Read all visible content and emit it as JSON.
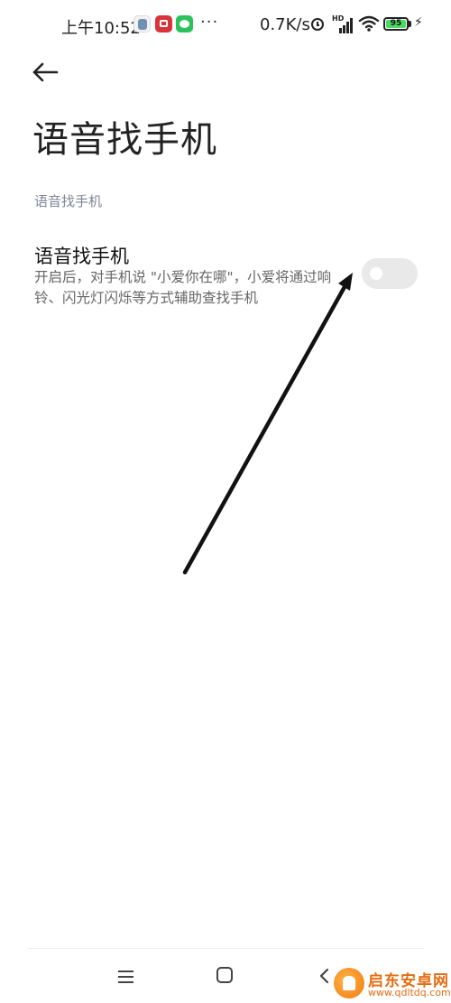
{
  "status_bar": {
    "time": "上午10:52",
    "more_notifications": "···",
    "network_speed": "0.7K/s",
    "signal_label": "HD",
    "battery_level": "95",
    "icons": [
      "app-notification-icon",
      "red-app-icon",
      "wechat-icon",
      "alarm-icon",
      "signal-icon",
      "wifi-icon",
      "battery-icon",
      "charging-icon"
    ]
  },
  "header": {
    "back_icon": "arrow-left-icon",
    "title": "语音找手机"
  },
  "section": {
    "header": "语音找手机"
  },
  "setting": {
    "title": "语音找手机",
    "description": "开启后，对手机说 \"小爱你在哪\"，小爱将通过响铃、闪光灯闪烁等方式辅助查找手机",
    "toggle_on": false
  },
  "nav_bar": {
    "icons": [
      "menu-icon",
      "home-icon",
      "back-icon"
    ]
  },
  "watermark": {
    "name": "启东安卓网",
    "url": "www.qdltdq.com"
  },
  "colors": {
    "background": "#ffffff",
    "toggle_off": "#e9e9ea",
    "section_header": "#7d8596",
    "watermark": "#e46d12"
  }
}
